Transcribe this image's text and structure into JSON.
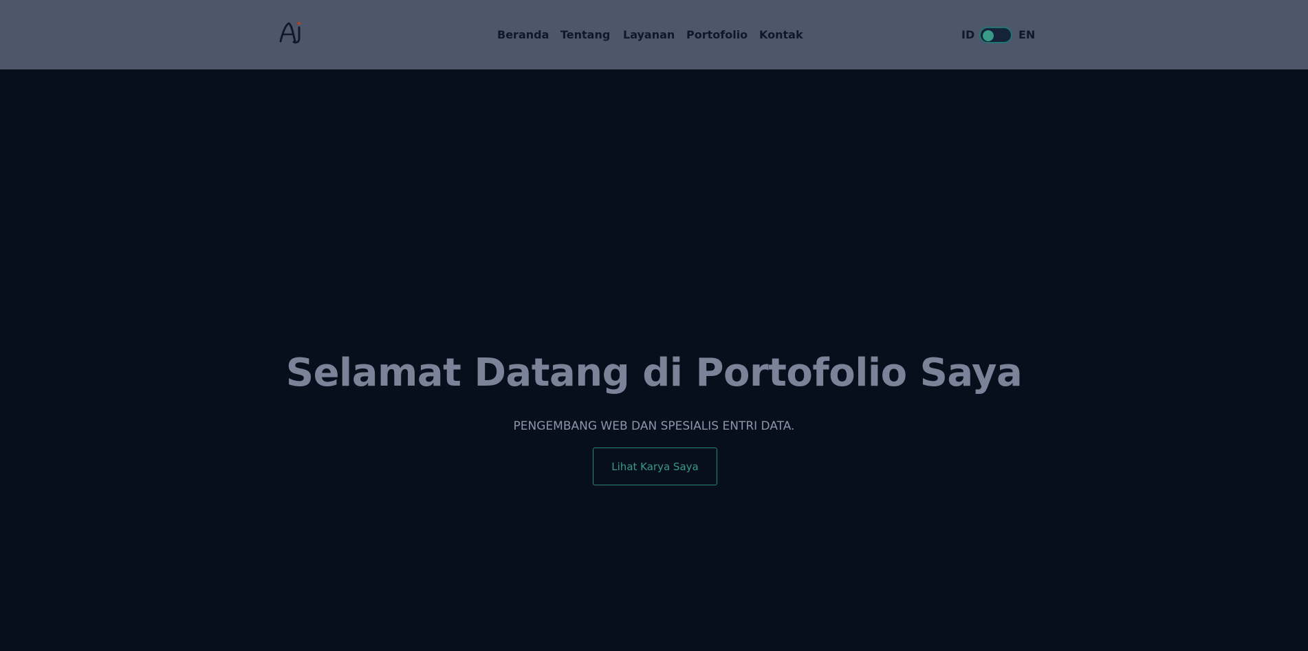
{
  "nav": {
    "logo_text": "AJ",
    "links": [
      {
        "label": "Beranda"
      },
      {
        "label": "Tentang"
      },
      {
        "label": "Layanan"
      },
      {
        "label": "Portofolio"
      },
      {
        "label": "Kontak"
      }
    ],
    "lang_left": "ID",
    "lang_right": "EN",
    "lang_toggle_state": "ID"
  },
  "hero": {
    "title": "Selamat Datang di Portofolio Saya",
    "subtitle": "PENGEMBANG WEB DAN SPESIALIS ENTRI DATA.",
    "button_label": "Lihat Karya Saya"
  },
  "colors": {
    "navbar_bg": "#4e566b",
    "page_bg": "#070e1c",
    "accent": "#3a9a88",
    "title": "#7b8399"
  }
}
